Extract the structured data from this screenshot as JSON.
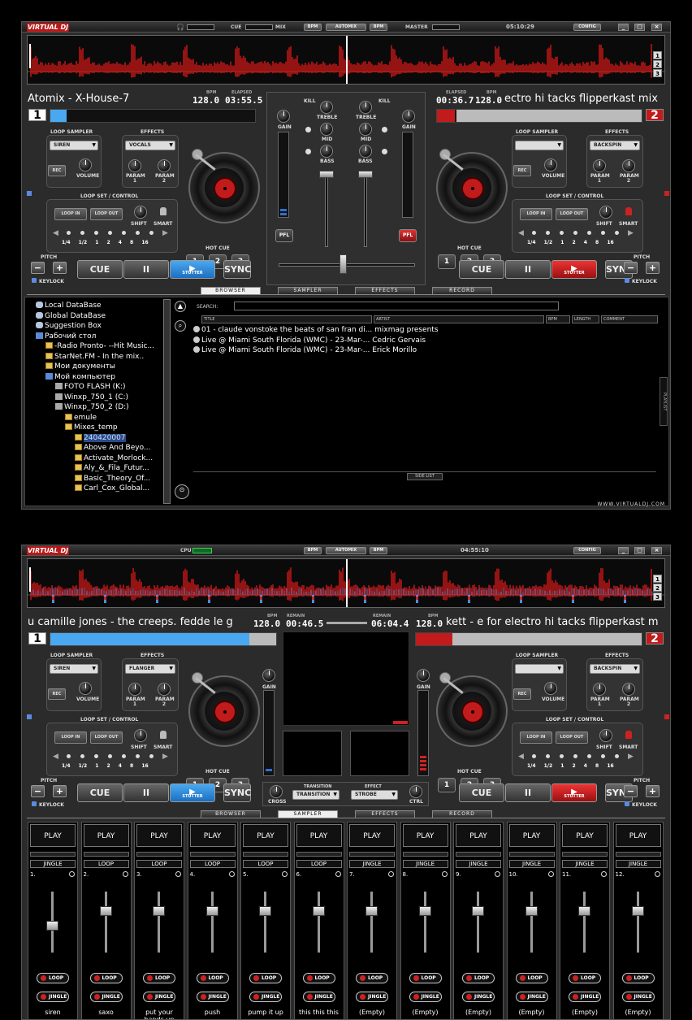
{
  "win1": {
    "logo": "VIRTUAL DJ",
    "cue": "CUE",
    "mix": "MIX",
    "bpm1": "BPM",
    "automix": "AUTOMIX",
    "bpm2": "BPM",
    "master": "MASTER",
    "time": "05:10:29",
    "config": "CONFIG",
    "wave_buttons": [
      "1",
      "2",
      "3"
    ],
    "left": {
      "title": "Atomix - X-House-7",
      "bpm_label": "BPM",
      "bpm": "128.0",
      "time_label": "ELAPSED",
      "time": "03:55.5",
      "deck": "1"
    },
    "right": {
      "time_label": "ELAPSED",
      "time": "00:36.7",
      "bpm_label": "BPM",
      "bpm": "128.0",
      "title": "ectro hi tacks flipperkast mix",
      "deck": "2"
    },
    "deck_left": {
      "loop_sampler": "LOOP SAMPLER",
      "effects": "EFFECTS",
      "sampler_select": "SIREN",
      "effect_select": "VOCALS",
      "rec": "REC",
      "volume": "VOLUME",
      "param1": "PARAM 1",
      "param2": "PARAM 2",
      "loop_set": "LOOP SET / CONTROL",
      "loop_in": "LOOP IN",
      "loop_out": "LOOP OUT",
      "shift": "SHIFT",
      "smart": "SMART",
      "loop_sizes": "1/4 1/2 1 2 4 8 16",
      "hot_cue": "HOT CUE",
      "hot_cues": [
        "1",
        "2",
        "3"
      ],
      "pitch": "PITCH",
      "keylock": "KEYLOCK",
      "cue": "CUE",
      "pause": "II",
      "stutter": "STUTTER",
      "sync": "SYNC"
    },
    "deck_right": {
      "loop_sampler": "LOOP SAMPLER",
      "effects": "EFFECTS",
      "sampler_select": "",
      "effect_select": "BACKSPIN",
      "rec": "REC",
      "volume": "VOLUME",
      "param1": "PARAM 1",
      "param2": "PARAM 2",
      "loop_set": "LOOP SET / CONTROL",
      "loop_in": "LOOP IN",
      "loop_out": "LOOP OUT",
      "shift": "SHIFT",
      "smart": "SMART",
      "loop_sizes": "1/4 1/2 1 2 4 8 16",
      "hot_cue": "HOT CUE",
      "hot_cues": [
        "1",
        "2",
        "3"
      ],
      "pitch": "PITCH",
      "keylock": "KEYLOCK",
      "cue": "CUE",
      "pause": "II",
      "stutter": "STUTTER",
      "sync": "SYNC"
    },
    "mixer": {
      "kill_l": "KILL",
      "kill_r": "KILL",
      "gain_l": "GAIN",
      "gain_r": "GAIN",
      "treble_l": "TREBLE",
      "treble_r": "TREBLE",
      "mid_l": "MID",
      "mid_r": "MID",
      "bass_l": "BASS",
      "bass_r": "BASS",
      "pfl_l": "PFL",
      "pfl_r": "PFL"
    },
    "tabs": [
      "BROWSER",
      "SAMPLER",
      "EFFECTS",
      "RECORD"
    ],
    "active_tab": 0,
    "browser": {
      "search_label": "SEARCH:",
      "columns": [
        "TITLE",
        "ARTIST",
        "BPM",
        "LENGTH",
        "COMMENT"
      ],
      "tree": [
        {
          "label": "Local DataBase",
          "indent": 0,
          "icon": "db"
        },
        {
          "label": "Global DataBase",
          "indent": 0,
          "icon": "db"
        },
        {
          "label": "Suggestion Box",
          "indent": 0,
          "icon": "db"
        },
        {
          "label": "Рабочий стол",
          "indent": 0,
          "icon": "pc"
        },
        {
          "label": "-Radio Pronto- --Hit Music...",
          "indent": 1,
          "icon": "fold"
        },
        {
          "label": "StarNet.FM - In the mix..",
          "indent": 1,
          "icon": "fold"
        },
        {
          "label": "Мои документы",
          "indent": 1,
          "icon": "fold"
        },
        {
          "label": "Мой компьютер",
          "indent": 1,
          "icon": "pc"
        },
        {
          "label": "FOTO FLASH (K:)",
          "indent": 2,
          "icon": "dr"
        },
        {
          "label": "Winxp_750_1 (C:)",
          "indent": 2,
          "icon": "dr"
        },
        {
          "label": "Winxp_750_2 (D:)",
          "indent": 2,
          "icon": "dr"
        },
        {
          "label": "emule",
          "indent": 3,
          "icon": "fold"
        },
        {
          "label": "Mixes_temp",
          "indent": 3,
          "icon": "fold"
        },
        {
          "label": "240420007",
          "indent": 4,
          "icon": "fold",
          "selected": true
        },
        {
          "label": "Above And Beyo...",
          "indent": 4,
          "icon": "fold"
        },
        {
          "label": "Activate_Morlock...",
          "indent": 4,
          "icon": "fold"
        },
        {
          "label": "Aly_&_Fila_Futur...",
          "indent": 4,
          "icon": "fold"
        },
        {
          "label": "Basic_Theory_Of...",
          "indent": 4,
          "icon": "fold"
        },
        {
          "label": "Carl_Cox_Global...",
          "indent": 4,
          "icon": "fold"
        }
      ],
      "rows": [
        {
          "title": "01 - claude vonstoke the beats of san fran di...",
          "artist": "mixmag presents"
        },
        {
          "title": "Live @ Miami South Florida (WMC) - 23-Mar-...",
          "artist": "Cedric Gervais"
        },
        {
          "title": "Live @ Miami South Florida (WMC) - 23-Mar-...",
          "artist": "Erick Morillo"
        }
      ],
      "side_list": "SIDE LIST",
      "playlist": "PLAYLIST"
    },
    "footer": "WWW.VIRTUALDJ.COM"
  },
  "win2": {
    "logo": "VIRTUAL DJ",
    "cpu": "CPU",
    "bpm1": "BPM",
    "automix": "AUTOMIX",
    "bpm2": "BPM",
    "time": "04:55:10",
    "config": "CONFIG",
    "wave_buttons": [
      "1",
      "2",
      "3"
    ],
    "left": {
      "title": "u camille jones - the creeps. fedde le g",
      "bpm_label": "BPM",
      "bpm": "128.0",
      "time_label": "REMAIN",
      "time": "00:46.5",
      "deck": "1"
    },
    "right": {
      "time_label": "REMAIN",
      "time": "06:04.4",
      "bpm_label": "BPM",
      "bpm": "128.0",
      "title": "kett - e for electro hi tacks flipperkast m",
      "deck": "2"
    },
    "deck_left": {
      "loop_sampler": "LOOP SAMPLER",
      "effects": "EFFECTS",
      "sampler_select": "SIREN",
      "effect_select": "FLANGER",
      "rec": "REC",
      "volume": "VOLUME",
      "param1": "PARAM 1",
      "param2": "PARAM 2",
      "loop_set": "LOOP SET / CONTROL",
      "loop_in": "LOOP IN",
      "loop_out": "LOOP OUT",
      "shift": "SHIFT",
      "smart": "SMART",
      "loop_sizes": "1/4 1/2 1 2 4 8 16",
      "hot_cue": "HOT CUE",
      "hot_cues": [
        "1",
        "2",
        "3"
      ],
      "pitch": "PITCH",
      "keylock": "KEYLOCK",
      "cue": "CUE",
      "pause": "II",
      "stutter": "STUTTER",
      "sync": "SYNC"
    },
    "deck_right": {
      "loop_sampler": "LOOP SAMPLER",
      "effects": "EFFECTS",
      "sampler_select": "",
      "effect_select": "BACKSPIN",
      "rec": "REC",
      "volume": "VOLUME",
      "param1": "PARAM 1",
      "param2": "PARAM 2",
      "loop_set": "LOOP SET / CONTROL",
      "loop_in": "LOOP IN",
      "loop_out": "LOOP OUT",
      "shift": "SHIFT",
      "smart": "SMART",
      "loop_sizes": "1/4 1/2 1 2 4 8 16",
      "hot_cue": "HOT CUE",
      "hot_cues": [
        "1",
        "2",
        "3"
      ],
      "pitch": "PITCH",
      "keylock": "KEYLOCK",
      "cue": "CUE",
      "pause": "II",
      "stutter": "STUTTER",
      "sync": "SYNC"
    },
    "center": {
      "gain_l": "GAIN",
      "gain_r": "GAIN",
      "cross": "CROSS",
      "transition_label": "TRANSITION",
      "transition": "TRANSITION",
      "effect_label": "EFFECT",
      "effect": "STROBE",
      "ctrl": "CTRL"
    },
    "tabs": [
      "BROWSER",
      "SAMPLER",
      "EFFECTS",
      "RECORD"
    ],
    "active_tab": 1,
    "sampler": [
      {
        "num": "1.",
        "mode": "JINGLE",
        "name": "siren",
        "level": 0.4
      },
      {
        "num": "2.",
        "mode": "LOOP",
        "name": "saxo",
        "level": 0.7
      },
      {
        "num": "3.",
        "mode": "LOOP",
        "name": "put your hands up",
        "level": 0.7
      },
      {
        "num": "4.",
        "mode": "LOOP",
        "name": "push",
        "level": 0.7
      },
      {
        "num": "5.",
        "mode": "LOOP",
        "name": "pump it up",
        "level": 0.7
      },
      {
        "num": "6.",
        "mode": "LOOP",
        "name": "this this this",
        "level": 0.7
      },
      {
        "num": "7.",
        "mode": "JINGLE",
        "name": "(Empty)",
        "level": 0.7
      },
      {
        "num": "8.",
        "mode": "JINGLE",
        "name": "(Empty)",
        "level": 0.7
      },
      {
        "num": "9.",
        "mode": "JINGLE",
        "name": "(Empty)",
        "level": 0.7
      },
      {
        "num": "10.",
        "mode": "JINGLE",
        "name": "(Empty)",
        "level": 0.7
      },
      {
        "num": "11.",
        "mode": "JINGLE",
        "name": "(Empty)",
        "level": 0.7
      },
      {
        "num": "12.",
        "mode": "JINGLE",
        "name": "(Empty)",
        "level": 0.7
      }
    ],
    "sampler_play": "PLAY",
    "sampler_loop": "LOOP",
    "sampler_jingle": "JINGLE"
  },
  "colors": {
    "accent_red": "#c21b1b",
    "accent_blue": "#4aa8f0",
    "wave_red": "#d01818"
  }
}
